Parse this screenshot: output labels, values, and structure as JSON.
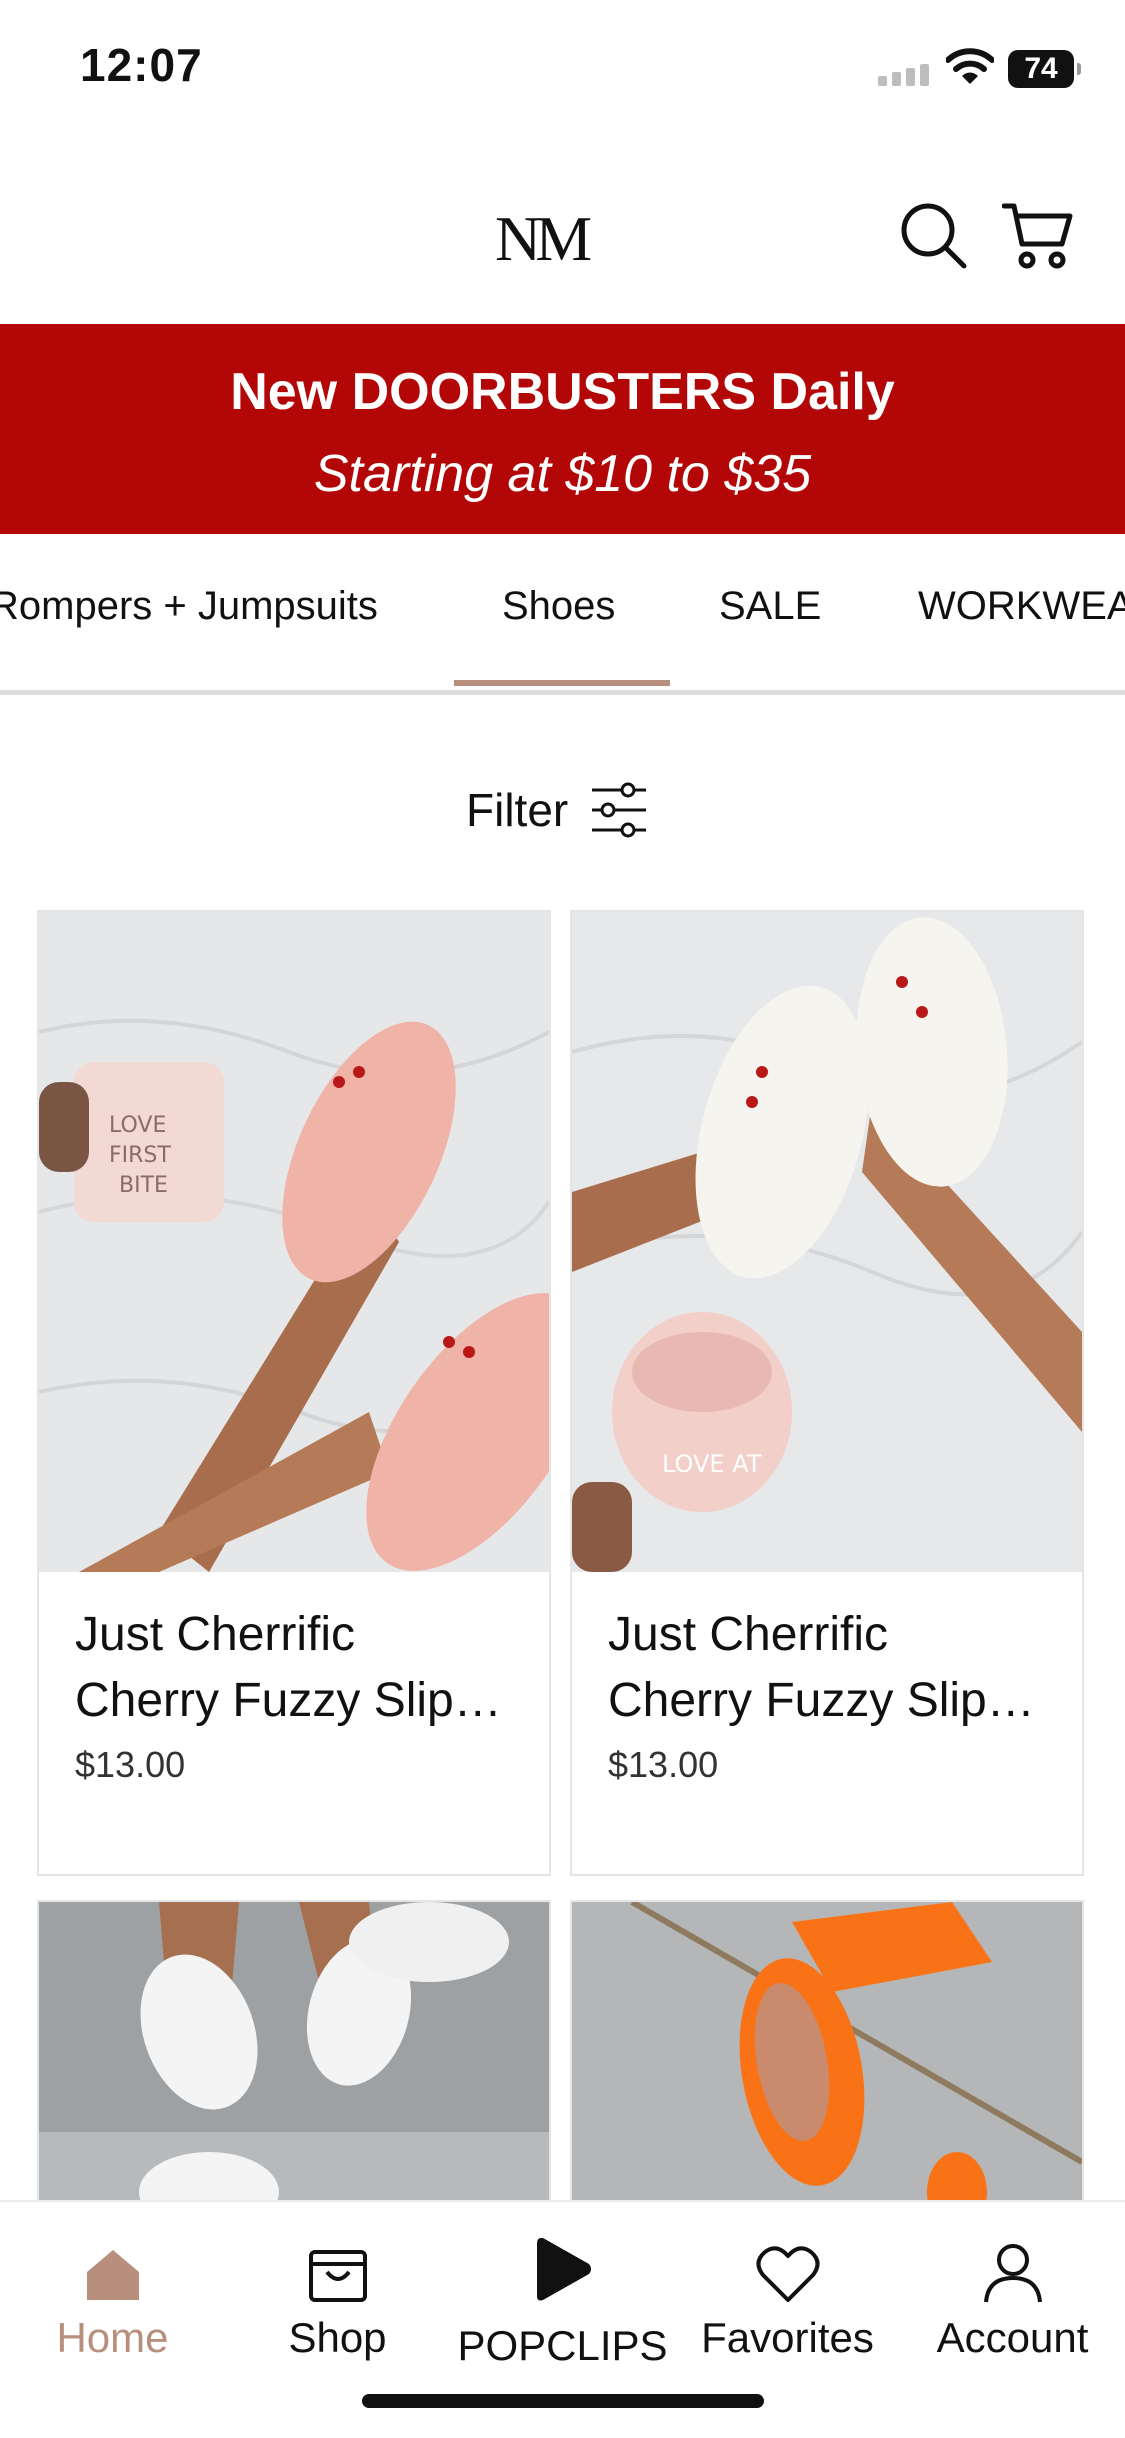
{
  "status_bar": {
    "time": "12:07",
    "battery": "74"
  },
  "header": {
    "logo": "NM",
    "logo_mark": "."
  },
  "promo": {
    "line1": "New DOORBUSTERS Daily",
    "line2": "Starting at $10 to $35"
  },
  "categories": {
    "tabs": [
      {
        "label": "Rompers + Jumpsuits"
      },
      {
        "label": "Shoes",
        "active": true
      },
      {
        "label": "SALE"
      },
      {
        "label": "WORKWEAR"
      }
    ]
  },
  "filter": {
    "label": "Filter"
  },
  "products": [
    {
      "name_line1": "Just Cherrific",
      "name_line2": "Cherry Fuzzy Slip…",
      "price": "$13.00",
      "slipper_color": "#f0b3a8"
    },
    {
      "name_line1": "Just Cherrific",
      "name_line2": "Cherry Fuzzy Slip…",
      "price": "$13.00",
      "slipper_color": "#f6f4ef"
    },
    {
      "slipper_color": "#f4f4f4"
    },
    {
      "slipper_color": "#f97316"
    }
  ],
  "bottom_nav": {
    "items": [
      {
        "label": "Home",
        "icon": "home-icon",
        "active": true
      },
      {
        "label": "Shop",
        "icon": "shopping-bag-icon"
      },
      {
        "label": "POPCLIPS",
        "icon": "play-icon"
      },
      {
        "label": "Favorites",
        "icon": "heart-icon"
      },
      {
        "label": "Account",
        "icon": "person-icon"
      }
    ]
  },
  "colors": {
    "brand_red": "#b30606",
    "accent_tan": "#b88f7d"
  }
}
